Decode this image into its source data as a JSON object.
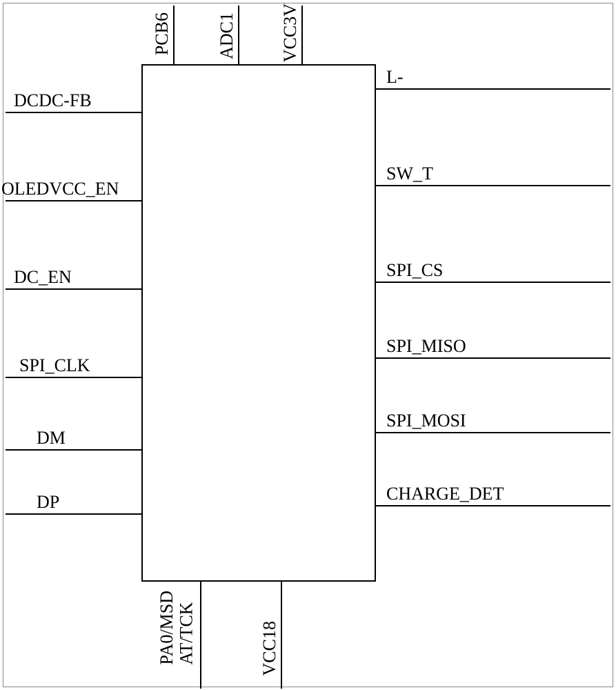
{
  "pins": {
    "top": [
      {
        "id": "pcb6",
        "label": "PCB6"
      },
      {
        "id": "adc1",
        "label": "ADC1"
      },
      {
        "id": "vcc3v",
        "label": "VCC3V"
      }
    ],
    "left": [
      {
        "id": "dcdc-fb",
        "label": "DCDC-FB"
      },
      {
        "id": "oledvcc-en",
        "label": "OLEDVCC_EN"
      },
      {
        "id": "dc-en",
        "label": "DC_EN"
      },
      {
        "id": "spi-clk",
        "label": "SPI_CLK"
      },
      {
        "id": "dm",
        "label": "DM"
      },
      {
        "id": "dp",
        "label": "DP"
      }
    ],
    "right": [
      {
        "id": "l-minus",
        "label": "L-"
      },
      {
        "id": "sw-t",
        "label": "SW_T"
      },
      {
        "id": "spi-cs",
        "label": "SPI_CS"
      },
      {
        "id": "spi-miso",
        "label": "SPI_MISO"
      },
      {
        "id": "spi-mosi",
        "label": "SPI_MOSI"
      },
      {
        "id": "charge-det",
        "label": "CHARGE_DET"
      }
    ],
    "bottom": [
      {
        "id": "pa0-msdat-tck",
        "label": "PA0/MSDAT/TCK"
      },
      {
        "id": "vcc18",
        "label": "VCC18"
      }
    ]
  }
}
